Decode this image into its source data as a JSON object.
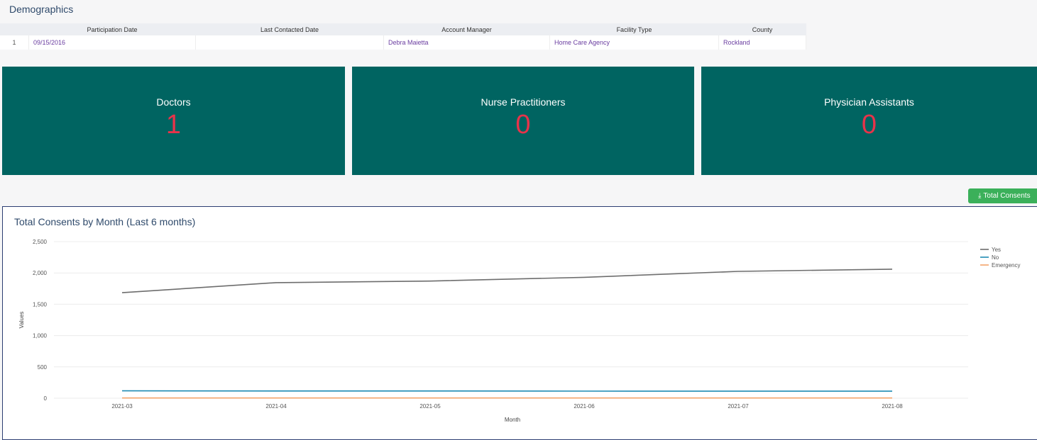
{
  "demographics": {
    "title": "Demographics",
    "columns": [
      "Participation Date",
      "Last Contacted Date",
      "Account Manager",
      "Facility Type",
      "County"
    ],
    "rows": [
      {
        "index": "1",
        "participation_date": "09/15/2016",
        "last_contacted_date": "",
        "account_manager": "Debra Maietta",
        "facility_type": "Home Care Agency",
        "county": "Rockland"
      }
    ]
  },
  "cards": [
    {
      "label": "Doctors",
      "value": "1"
    },
    {
      "label": "Nurse Practitioners",
      "value": "0"
    },
    {
      "label": "Physician Assistants",
      "value": "0"
    }
  ],
  "export_button": {
    "label": "Total Consents",
    "icon": "download-icon"
  },
  "colors": {
    "card_bg": "#006461",
    "card_value": "#e8334a",
    "button": "#3bb05a",
    "series_yes": "#6d6d6d",
    "series_no": "#1f8bb3",
    "series_emergency": "#f3a36a"
  },
  "chart_data": {
    "type": "line",
    "title": "Total Consents by Month (Last 6 months)",
    "xlabel": "Month",
    "ylabel": "Values",
    "categories": [
      "2021-03",
      "2021-04",
      "2021-05",
      "2021-06",
      "2021-07",
      "2021-08"
    ],
    "ylim": [
      0,
      2500
    ],
    "yticks": [
      "0",
      "500",
      "1,000",
      "1,500",
      "2,000",
      "2,500"
    ],
    "grid": true,
    "legend": "top-right",
    "series": [
      {
        "name": "Yes",
        "values": [
          1685,
          1845,
          1870,
          1930,
          2025,
          2060
        ]
      },
      {
        "name": "No",
        "values": [
          118,
          115,
          115,
          113,
          112,
          112
        ]
      },
      {
        "name": "Emergency",
        "values": [
          3,
          3,
          3,
          3,
          3,
          3
        ]
      }
    ]
  }
}
